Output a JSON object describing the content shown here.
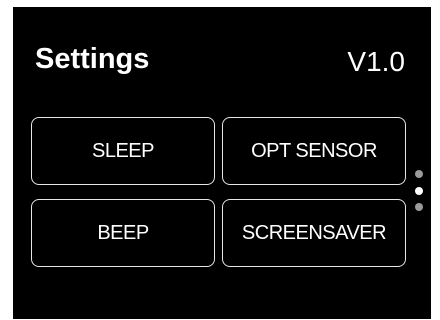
{
  "header": {
    "title": "Settings",
    "version": "V1.0"
  },
  "buttons": {
    "sleep": "SLEEP",
    "opt_sensor": "OPT SENSOR",
    "beep": "BEEP",
    "screensaver": "SCREENSAVER"
  },
  "pager": {
    "page_count": 3,
    "current_page": 2
  },
  "colors": {
    "background": "#000000",
    "text": "#ffffff",
    "button_border": "#e6e6e6",
    "dot_inactive": "#9a9a9a",
    "dot_active": "#ffffff"
  }
}
